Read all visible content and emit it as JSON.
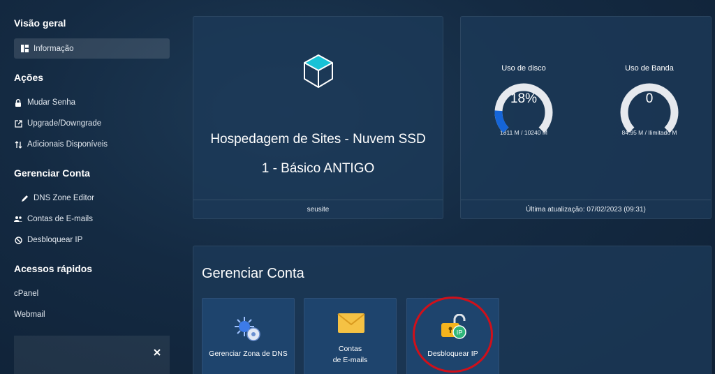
{
  "sidebar": {
    "overview_title": "Visão geral",
    "overview_items": [
      {
        "label": "Informação",
        "icon": "dashboard-icon"
      }
    ],
    "actions_title": "Ações",
    "actions_items": [
      {
        "label": "Mudar Senha",
        "icon": "lock-icon"
      },
      {
        "label": "Upgrade/Downgrade",
        "icon": "external-link-icon"
      },
      {
        "label": "Adicionais Disponíveis",
        "icon": "swap-icon"
      }
    ],
    "manage_title": "Gerenciar Conta",
    "manage_items": [
      {
        "label": "DNS Zone Editor",
        "icon": "pencil-icon"
      },
      {
        "label": "Contas de E-mails",
        "icon": "users-icon"
      },
      {
        "label": "Desbloquear IP",
        "icon": "ban-icon"
      }
    ],
    "quick_title": "Acessos rápidos",
    "quick_items": [
      {
        "label": "cPanel"
      },
      {
        "label": "Webmail"
      }
    ]
  },
  "plan": {
    "title": "Hospedagem de Sites - Nuvem SSD 1 - Básico ANTIGO",
    "footer": "seusite",
    "icon": "cube-icon"
  },
  "usage": {
    "disk": {
      "label": "Uso de disco",
      "value_text": "18%",
      "percent": 18,
      "detail": "1811 M / 10240 M"
    },
    "bandwidth": {
      "label": "Uso de Banda",
      "value_text": "0",
      "percent": 0,
      "detail": "84.95 M / Ilimitado M"
    },
    "footer": "Última atualização: 07/02/2023 (09:31)"
  },
  "manage": {
    "title": "Gerenciar Conta",
    "tiles": [
      {
        "label": "Gerenciar Zona de DNS",
        "icon": "dns-zone-icon"
      },
      {
        "label_line1": "Contas",
        "label_line2": "de E-mails",
        "icon": "envelope-icon"
      },
      {
        "label": "Desbloquear IP",
        "icon": "unlock-ip-icon"
      }
    ]
  },
  "colors": {
    "accent": "#1565d8",
    "gauge_track": "#e6e9ee",
    "highlight": "#d0101a",
    "tile": "#204672"
  }
}
